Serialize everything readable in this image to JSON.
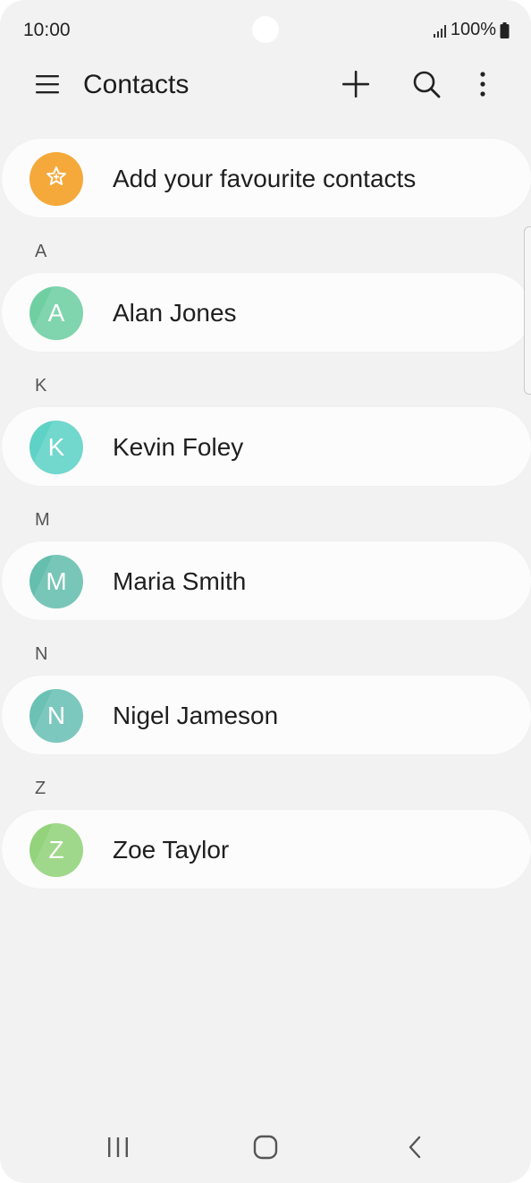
{
  "status_bar": {
    "time": "10:00",
    "battery": "100%",
    "icons": [
      "signal-icon",
      "battery-icon"
    ]
  },
  "app_bar": {
    "title": "Contacts",
    "icons": [
      "menu-icon",
      "add-icon",
      "search-icon",
      "more-options-icon"
    ]
  },
  "favourites": {
    "label": "Add your favourite contacts",
    "icon": "star-icon",
    "color": "#f5a93b"
  },
  "sections": [
    {
      "letter": "A",
      "contact": {
        "initial": "A",
        "name": "Alan Jones",
        "color": "#6fcfa3"
      }
    },
    {
      "letter": "K",
      "contact": {
        "initial": "K",
        "name": "Kevin Foley",
        "color": "#5fd2c6"
      }
    },
    {
      "letter": "M",
      "contact": {
        "initial": "M",
        "name": "Maria Smith",
        "color": "#66bfae"
      }
    },
    {
      "letter": "N",
      "contact": {
        "initial": "N",
        "name": "Nigel Jameson",
        "color": "#6cc1b5"
      }
    },
    {
      "letter": "Z",
      "contact": {
        "initial": "Z",
        "name": "Zoe Taylor",
        "color": "#93d37c"
      }
    }
  ],
  "nav_bar": {
    "icons": [
      "recents-icon",
      "home-icon",
      "back-icon"
    ]
  }
}
